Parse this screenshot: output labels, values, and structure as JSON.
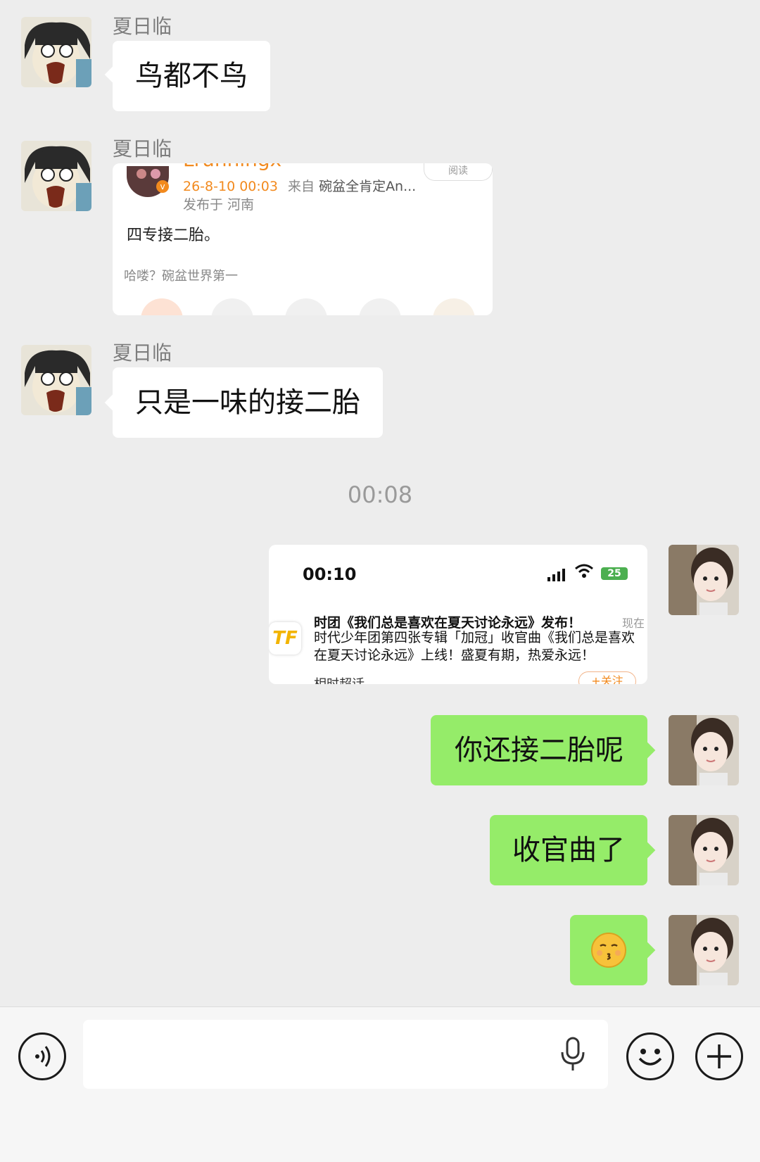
{
  "messages": {
    "m1": {
      "sender": "夏日临",
      "text": "鸟都不鸟"
    },
    "m2": {
      "sender": "夏日临",
      "card": {
        "user": "Lrunningx",
        "views_label": "阅读",
        "date": "26-8-10 00:03",
        "source_prefix": "来自",
        "source": "碗盆全肯定An...",
        "location": "发布于 河南",
        "body": "四专接二胎。",
        "comment": "哈喽？碗盆世界第一"
      }
    },
    "m3": {
      "sender": "夏日临",
      "text": "只是一味的接二胎"
    },
    "timestamp": "00:08",
    "m4": {
      "card": {
        "status_time": "00:10",
        "battery": "25",
        "app_logo": "TF",
        "notif_time": "现在",
        "notif_title": "时团《我们总是喜欢在夏天讨论永远》发布！",
        "notif_body": "时代少年团第四张专辑「加冠」收官曲《我们总是喜欢在夏天讨论永远》上线！盛夏有期，热爱永远！",
        "bottom_left": "相时超话",
        "bottom_right": "+关注"
      }
    },
    "m5": {
      "text": "你还接二胎呢"
    },
    "m6": {
      "text": "收官曲了"
    },
    "m7": {
      "emoji": "😚"
    }
  },
  "inputbar": {
    "voice_icon": "voice-toggle-icon",
    "mic_icon": "microphone-icon",
    "emoji_icon": "emoji-face-icon",
    "plus_icon": "plus-icon"
  },
  "colors": {
    "bg": "#ededed",
    "bubble_out": "#95ec69",
    "bubble_in": "#ffffff",
    "weibo_orange": "#f28a1e"
  }
}
